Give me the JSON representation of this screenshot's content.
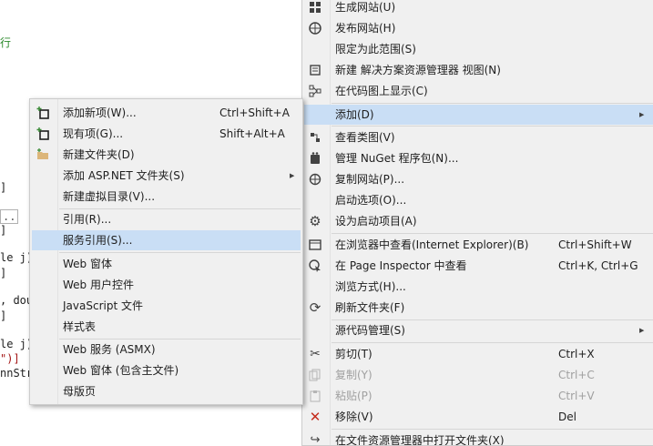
{
  "code_fragments": [
    {
      "text": "行",
      "color": "#2b8a2b"
    },
    {
      "text": "]",
      "color": "#1e1e1e"
    },
    {
      "text": "..",
      "color": "#555555"
    },
    {
      "text": "]",
      "color": "#1e1e1e"
    },
    {
      "text": "le j)",
      "color": "#1e1e1e"
    },
    {
      "text": "]",
      "color": "#1e1e1e"
    },
    {
      "text": ", dou",
      "color": "#1e1e1e"
    },
    {
      "text": "]",
      "color": "#1e1e1e"
    },
    {
      "text": "le j)",
      "color": "#1e1e1e"
    },
    {
      "text": "\")]",
      "color": "#a31515"
    },
    {
      "text": "nnStr",
      "color": "#1e1e1e"
    }
  ],
  "main_menu": {
    "items": [
      {
        "label": "生成网站(U)",
        "shortcut": "",
        "icon": "build-web-icon"
      },
      {
        "label": "发布网站(H)",
        "shortcut": "",
        "icon": "publish-globe-icon"
      },
      {
        "label": "限定为此范围(S)",
        "shortcut": "",
        "icon": ""
      },
      {
        "label": "新建 解决方案资源管理器 视图(N)",
        "shortcut": "",
        "icon": "new-view-icon"
      },
      {
        "label": "在代码图上显示(C)",
        "shortcut": "",
        "icon": "code-map-icon"
      },
      {
        "label": "添加(D)",
        "shortcut": "",
        "icon": ""
      },
      {
        "label": "查看类图(V)",
        "shortcut": "",
        "icon": "class-diagram-icon"
      },
      {
        "label": "管理 NuGet 程序包(N)...",
        "shortcut": "",
        "icon": "nuget-icon"
      },
      {
        "label": "复制网站(P)...",
        "shortcut": "",
        "icon": "copy-web-icon"
      },
      {
        "label": "启动选项(O)...",
        "shortcut": "",
        "icon": ""
      },
      {
        "label": "设为启动项目(A)",
        "shortcut": "",
        "icon": "gear-icon"
      },
      {
        "label": "在浏览器中查看(Internet Explorer)(B)",
        "shortcut": "Ctrl+Shift+W",
        "icon": "browser-view-icon"
      },
      {
        "label": "在 Page Inspector 中查看",
        "shortcut": "Ctrl+K, Ctrl+G",
        "icon": "page-inspector-icon"
      },
      {
        "label": "浏览方式(H)...",
        "shortcut": "",
        "icon": ""
      },
      {
        "label": "刷新文件夹(F)",
        "shortcut": "",
        "icon": "refresh-icon"
      },
      {
        "label": "源代码管理(S)",
        "shortcut": "",
        "icon": ""
      },
      {
        "label": "剪切(T)",
        "shortcut": "Ctrl+X",
        "icon": "scissors-icon"
      },
      {
        "label": "复制(Y)",
        "shortcut": "Ctrl+C",
        "icon": "copy-icon"
      },
      {
        "label": "粘贴(P)",
        "shortcut": "Ctrl+V",
        "icon": "paste-icon"
      },
      {
        "label": "移除(V)",
        "shortcut": "Del",
        "icon": "remove-x-icon"
      },
      {
        "label": "在文件资源管理器中打开文件夹(X)",
        "shortcut": "",
        "icon": "open-folder-icon"
      }
    ],
    "highlighted_label": "添加(D)"
  },
  "sub_menu": {
    "items": [
      {
        "label": "添加新项(W)...",
        "shortcut": "Ctrl+Shift+A",
        "icon": "new-item-icon"
      },
      {
        "label": "现有项(G)...",
        "shortcut": "Shift+Alt+A",
        "icon": "existing-item-icon"
      },
      {
        "label": "新建文件夹(D)",
        "shortcut": "",
        "icon": "new-folder-icon"
      },
      {
        "label": "添加 ASP.NET 文件夹(S)",
        "shortcut": "",
        "icon": ""
      },
      {
        "label": "新建虚拟目录(V)...",
        "shortcut": "",
        "icon": ""
      },
      {
        "label": "引用(R)...",
        "shortcut": "",
        "icon": ""
      },
      {
        "label": "服务引用(S)...",
        "shortcut": "",
        "icon": ""
      },
      {
        "label": "Web 窗体",
        "shortcut": "",
        "icon": ""
      },
      {
        "label": "Web 用户控件",
        "shortcut": "",
        "icon": ""
      },
      {
        "label": "JavaScript 文件",
        "shortcut": "",
        "icon": ""
      },
      {
        "label": "样式表",
        "shortcut": "",
        "icon": ""
      },
      {
        "label": "Web 服务 (ASMX)",
        "shortcut": "",
        "icon": ""
      },
      {
        "label": "Web 窗体 (包含主文件)",
        "shortcut": "",
        "icon": ""
      },
      {
        "label": "母版页",
        "shortcut": "",
        "icon": ""
      }
    ],
    "highlighted_label": "服务引用(S)..."
  },
  "colors": {
    "menu_bg": "#f0f0f0",
    "highlight": "#c9def5",
    "disabled_text": "#a0a0a0",
    "remove_icon": "#c42b1c"
  }
}
